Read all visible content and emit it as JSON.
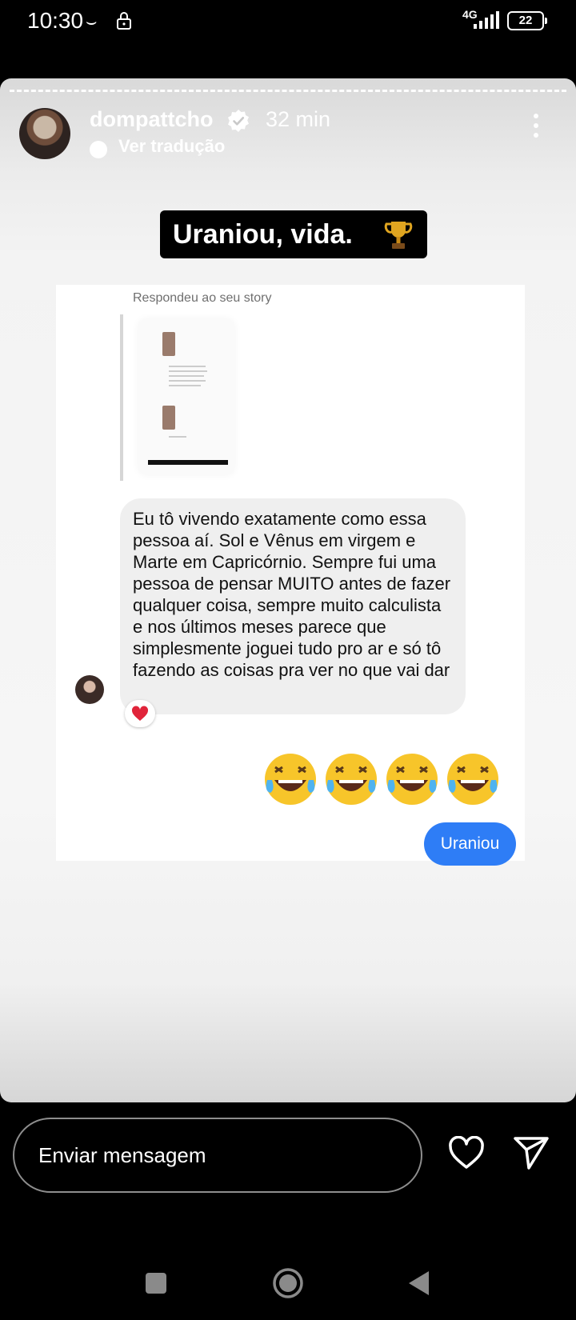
{
  "status_bar": {
    "time": "10:30",
    "network": "4G",
    "battery": "22"
  },
  "story": {
    "username": "dompattcho",
    "time_ago": "32 min",
    "translate_label": "Ver tradução",
    "sticker_text": "Uraniou, vida.",
    "sticker_icon": "trophy-icon",
    "reply_label": "Respondeu ao seu story",
    "message_text": "Eu tô vivendo exatamente como essa pessoa aí. Sol e Vênus em virgem e Marte em Capricórnio. Sempre fui uma pessoa de pensar MUITO antes de fazer qualquer coisa, sempre muito calculista e nos últimos meses parece que simplesmente joguei tudo pro ar e só tô fazendo as coisas pra ver no que vai dar",
    "reaction": "heart",
    "emoji_reply": "face-with-tears-of-joy",
    "emoji_count": 4,
    "sent_reply": "Uraniou"
  },
  "composer": {
    "placeholder": "Enviar mensagem"
  },
  "colors": {
    "sent_bubble": "#2e7df6",
    "received_bubble": "#efefef",
    "background": "#000000"
  }
}
